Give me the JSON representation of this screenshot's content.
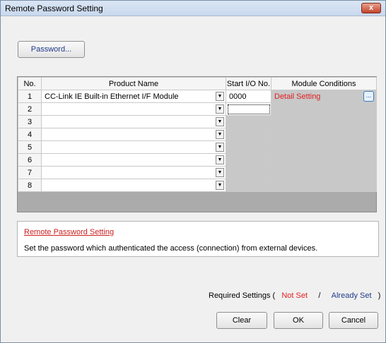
{
  "window": {
    "title": "Remote Password Setting",
    "close_label": "x"
  },
  "password_button": "Password...",
  "table": {
    "headers": [
      "No.",
      "Product Name",
      "Start I/O No.",
      "Module Conditions"
    ],
    "rows": [
      {
        "no": "1",
        "product": "CC-Link IE Built-in Ethernet I/F Module",
        "start_io": "0000",
        "condition": "Detail Setting"
      },
      {
        "no": "2",
        "product": "",
        "start_io": "",
        "condition": ""
      },
      {
        "no": "3",
        "product": "",
        "start_io": "",
        "condition": ""
      },
      {
        "no": "4",
        "product": "",
        "start_io": "",
        "condition": ""
      },
      {
        "no": "5",
        "product": "",
        "start_io": "",
        "condition": ""
      },
      {
        "no": "6",
        "product": "",
        "start_io": "",
        "condition": ""
      },
      {
        "no": "7",
        "product": "",
        "start_io": "",
        "condition": ""
      },
      {
        "no": "8",
        "product": "",
        "start_io": "",
        "condition": ""
      }
    ],
    "ellipsis_label": "..."
  },
  "description": {
    "title": "Remote Password Setting",
    "text": "Set the password which authenticated the access (connection) from external devices."
  },
  "legend": {
    "prefix": "Required Settings (",
    "not_set": "Not Set",
    "separator": "/",
    "already_set": "Already Set",
    "suffix": ")"
  },
  "buttons": {
    "clear": "Clear",
    "ok": "OK",
    "cancel": "Cancel"
  },
  "colors": {
    "not_set": "#e02020",
    "already_set": "#1f3b8a",
    "detail_setting": "#e02020"
  }
}
